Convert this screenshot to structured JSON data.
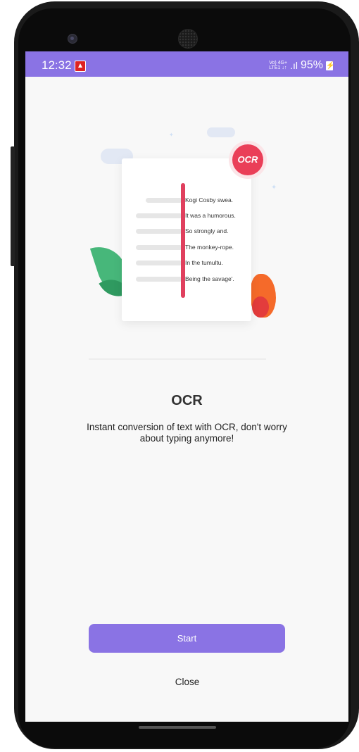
{
  "status_bar": {
    "time": "12:32",
    "network_top": "Vo) 4G+",
    "network_bottom": "LTE1 ↓↑",
    "battery": "95%",
    "color": "#8a73e4"
  },
  "illustration": {
    "badge_text": "OCR",
    "doc_lines": [
      "Kogi Cosby swea.",
      "It was a humorous.",
      "So strongly and.",
      "The monkey-rope.",
      "In the tumultu.",
      "Being the savage'."
    ]
  },
  "content": {
    "title": "OCR",
    "description": "Instant conversion of text with OCR, don't worry about typing anymore!"
  },
  "actions": {
    "start_label": "Start",
    "close_label": "Close"
  }
}
